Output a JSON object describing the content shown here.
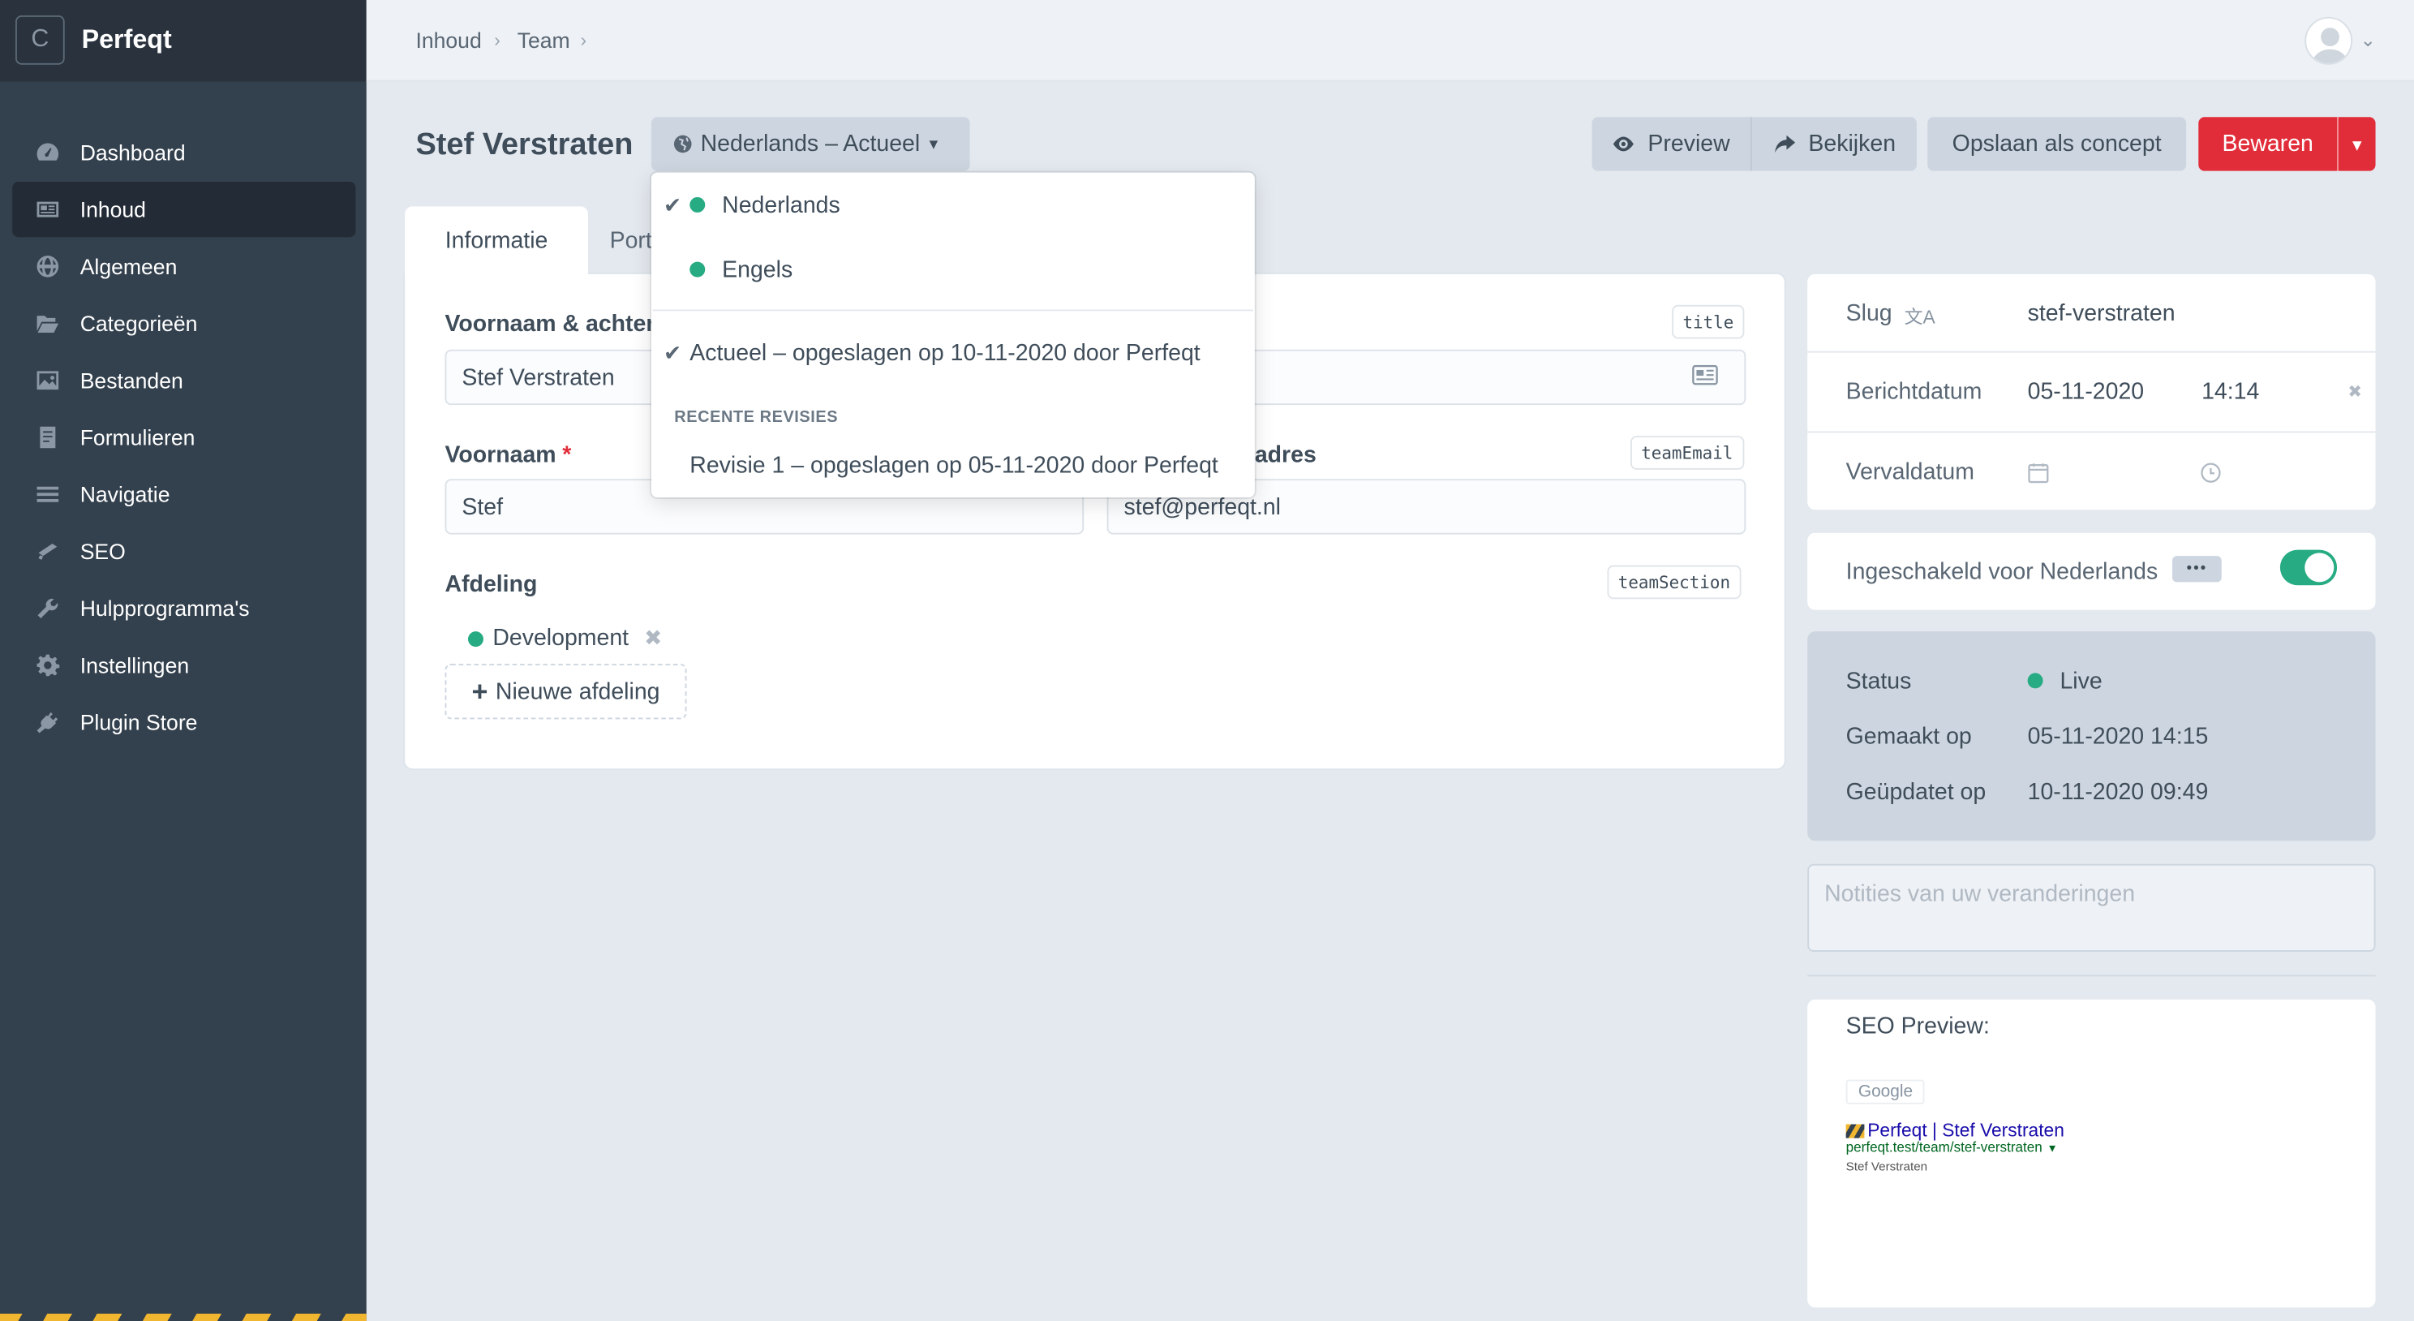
{
  "app": {
    "logo_letter": "C",
    "site_name": "Perfeqt"
  },
  "sidebar": {
    "items": [
      {
        "label": "Dashboard",
        "icon": "dashboard-icon"
      },
      {
        "label": "Inhoud",
        "icon": "newspaper-icon",
        "active": true
      },
      {
        "label": "Algemeen",
        "icon": "globe-icon"
      },
      {
        "label": "Categorieën",
        "icon": "folder-open-icon"
      },
      {
        "label": "Bestanden",
        "icon": "image-icon"
      },
      {
        "label": "Formulieren",
        "icon": "form-icon"
      },
      {
        "label": "Navigatie",
        "icon": "menu-icon"
      },
      {
        "label": "SEO",
        "icon": "seo-icon"
      },
      {
        "label": "Hulpprogramma's",
        "icon": "wrench-icon"
      },
      {
        "label": "Instellingen",
        "icon": "gear-icon"
      },
      {
        "label": "Plugin Store",
        "icon": "plug-icon"
      }
    ]
  },
  "breadcrumb": [
    "Inhoud",
    "Team"
  ],
  "header": {
    "title": "Stef Verstraten",
    "site_menu": "Nederlands – Actueel",
    "preview": "Preview",
    "view": "Bekijken",
    "save_draft": "Opslaan als concept",
    "save": "Bewaren"
  },
  "tabs": [
    "Informatie",
    "Port"
  ],
  "form": {
    "fullname_label": "Voornaam & achter",
    "fullname_handle": "title",
    "fullname_value": "Stef Verstraten",
    "firstname_label": "Voornaam",
    "firstname_handle": "",
    "firstname_value": "Stef",
    "email_label": "adres",
    "email_handle": "teamEmail",
    "email_value": "stef@perfeqt.nl",
    "section_label": "Afdeling",
    "section_handle": "teamSection",
    "section_item": "Development",
    "new_section": "Nieuwe afdeling"
  },
  "dropdown": {
    "sites": [
      "Nederlands",
      "Engels"
    ],
    "current": "Actueel – opgeslagen op 10-11-2020 door Perfeqt",
    "recent_heading": "RECENTE REVISIES",
    "revision": "Revisie 1 – opgeslagen op 05-11-2020 door Perfeqt"
  },
  "meta": {
    "slug_label": "Slug",
    "slug_value": "stef-verstraten",
    "postdate_label": "Berichtdatum",
    "postdate_date": "05-11-2020",
    "postdate_time": "14:14",
    "expiry_label": "Vervaldatum"
  },
  "enabled": {
    "label": "Ingeschakeld voor Nederlands",
    "dots": "•••",
    "on": true
  },
  "status": {
    "status_label": "Status",
    "status_value": "Live",
    "created_label": "Gemaakt op",
    "created_value": "05-11-2020 14:15",
    "updated_label": "Geüpdatet op",
    "updated_value": "10-11-2020 09:49"
  },
  "notes": {
    "placeholder": "Notities van uw veranderingen"
  },
  "seo": {
    "heading": "SEO Preview:",
    "engine": "Google",
    "result_title": "Perfeqt | Stef Verstraten",
    "result_url": "perfeqt.test/team/stef-verstraten",
    "result_desc": "Stef Verstraten"
  },
  "colors": {
    "sidebar": "#33404d",
    "accent_red": "#e12d39",
    "green": "#27ab83"
  }
}
